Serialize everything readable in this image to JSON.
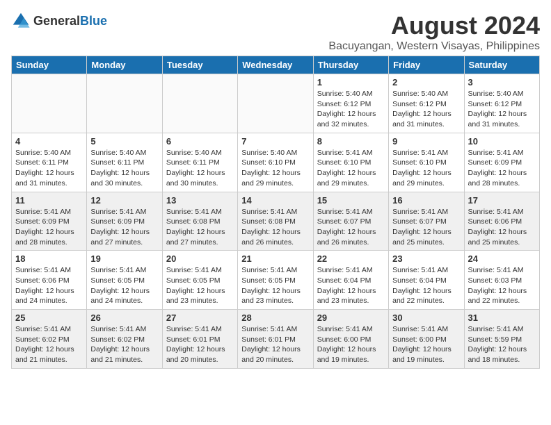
{
  "header": {
    "logo_general": "General",
    "logo_blue": "Blue",
    "month_year": "August 2024",
    "location": "Bacuyangan, Western Visayas, Philippines"
  },
  "days_of_week": [
    "Sunday",
    "Monday",
    "Tuesday",
    "Wednesday",
    "Thursday",
    "Friday",
    "Saturday"
  ],
  "weeks": [
    [
      {
        "day": "",
        "empty": true
      },
      {
        "day": "",
        "empty": true
      },
      {
        "day": "",
        "empty": true
      },
      {
        "day": "",
        "empty": true
      },
      {
        "day": "1",
        "sunrise": "Sunrise: 5:40 AM",
        "sunset": "Sunset: 6:12 PM",
        "daylight": "Daylight: 12 hours and 32 minutes."
      },
      {
        "day": "2",
        "sunrise": "Sunrise: 5:40 AM",
        "sunset": "Sunset: 6:12 PM",
        "daylight": "Daylight: 12 hours and 31 minutes."
      },
      {
        "day": "3",
        "sunrise": "Sunrise: 5:40 AM",
        "sunset": "Sunset: 6:12 PM",
        "daylight": "Daylight: 12 hours and 31 minutes."
      }
    ],
    [
      {
        "day": "4",
        "sunrise": "Sunrise: 5:40 AM",
        "sunset": "Sunset: 6:11 PM",
        "daylight": "Daylight: 12 hours and 31 minutes."
      },
      {
        "day": "5",
        "sunrise": "Sunrise: 5:40 AM",
        "sunset": "Sunset: 6:11 PM",
        "daylight": "Daylight: 12 hours and 30 minutes."
      },
      {
        "day": "6",
        "sunrise": "Sunrise: 5:40 AM",
        "sunset": "Sunset: 6:11 PM",
        "daylight": "Daylight: 12 hours and 30 minutes."
      },
      {
        "day": "7",
        "sunrise": "Sunrise: 5:40 AM",
        "sunset": "Sunset: 6:10 PM",
        "daylight": "Daylight: 12 hours and 29 minutes."
      },
      {
        "day": "8",
        "sunrise": "Sunrise: 5:41 AM",
        "sunset": "Sunset: 6:10 PM",
        "daylight": "Daylight: 12 hours and 29 minutes."
      },
      {
        "day": "9",
        "sunrise": "Sunrise: 5:41 AM",
        "sunset": "Sunset: 6:10 PM",
        "daylight": "Daylight: 12 hours and 29 minutes."
      },
      {
        "day": "10",
        "sunrise": "Sunrise: 5:41 AM",
        "sunset": "Sunset: 6:09 PM",
        "daylight": "Daylight: 12 hours and 28 minutes."
      }
    ],
    [
      {
        "day": "11",
        "sunrise": "Sunrise: 5:41 AM",
        "sunset": "Sunset: 6:09 PM",
        "daylight": "Daylight: 12 hours and 28 minutes."
      },
      {
        "day": "12",
        "sunrise": "Sunrise: 5:41 AM",
        "sunset": "Sunset: 6:09 PM",
        "daylight": "Daylight: 12 hours and 27 minutes."
      },
      {
        "day": "13",
        "sunrise": "Sunrise: 5:41 AM",
        "sunset": "Sunset: 6:08 PM",
        "daylight": "Daylight: 12 hours and 27 minutes."
      },
      {
        "day": "14",
        "sunrise": "Sunrise: 5:41 AM",
        "sunset": "Sunset: 6:08 PM",
        "daylight": "Daylight: 12 hours and 26 minutes."
      },
      {
        "day": "15",
        "sunrise": "Sunrise: 5:41 AM",
        "sunset": "Sunset: 6:07 PM",
        "daylight": "Daylight: 12 hours and 26 minutes."
      },
      {
        "day": "16",
        "sunrise": "Sunrise: 5:41 AM",
        "sunset": "Sunset: 6:07 PM",
        "daylight": "Daylight: 12 hours and 25 minutes."
      },
      {
        "day": "17",
        "sunrise": "Sunrise: 5:41 AM",
        "sunset": "Sunset: 6:06 PM",
        "daylight": "Daylight: 12 hours and 25 minutes."
      }
    ],
    [
      {
        "day": "18",
        "sunrise": "Sunrise: 5:41 AM",
        "sunset": "Sunset: 6:06 PM",
        "daylight": "Daylight: 12 hours and 24 minutes."
      },
      {
        "day": "19",
        "sunrise": "Sunrise: 5:41 AM",
        "sunset": "Sunset: 6:05 PM",
        "daylight": "Daylight: 12 hours and 24 minutes."
      },
      {
        "day": "20",
        "sunrise": "Sunrise: 5:41 AM",
        "sunset": "Sunset: 6:05 PM",
        "daylight": "Daylight: 12 hours and 23 minutes."
      },
      {
        "day": "21",
        "sunrise": "Sunrise: 5:41 AM",
        "sunset": "Sunset: 6:05 PM",
        "daylight": "Daylight: 12 hours and 23 minutes."
      },
      {
        "day": "22",
        "sunrise": "Sunrise: 5:41 AM",
        "sunset": "Sunset: 6:04 PM",
        "daylight": "Daylight: 12 hours and 23 minutes."
      },
      {
        "day": "23",
        "sunrise": "Sunrise: 5:41 AM",
        "sunset": "Sunset: 6:04 PM",
        "daylight": "Daylight: 12 hours and 22 minutes."
      },
      {
        "day": "24",
        "sunrise": "Sunrise: 5:41 AM",
        "sunset": "Sunset: 6:03 PM",
        "daylight": "Daylight: 12 hours and 22 minutes."
      }
    ],
    [
      {
        "day": "25",
        "sunrise": "Sunrise: 5:41 AM",
        "sunset": "Sunset: 6:02 PM",
        "daylight": "Daylight: 12 hours and 21 minutes."
      },
      {
        "day": "26",
        "sunrise": "Sunrise: 5:41 AM",
        "sunset": "Sunset: 6:02 PM",
        "daylight": "Daylight: 12 hours and 21 minutes."
      },
      {
        "day": "27",
        "sunrise": "Sunrise: 5:41 AM",
        "sunset": "Sunset: 6:01 PM",
        "daylight": "Daylight: 12 hours and 20 minutes."
      },
      {
        "day": "28",
        "sunrise": "Sunrise: 5:41 AM",
        "sunset": "Sunset: 6:01 PM",
        "daylight": "Daylight: 12 hours and 20 minutes."
      },
      {
        "day": "29",
        "sunrise": "Sunrise: 5:41 AM",
        "sunset": "Sunset: 6:00 PM",
        "daylight": "Daylight: 12 hours and 19 minutes."
      },
      {
        "day": "30",
        "sunrise": "Sunrise: 5:41 AM",
        "sunset": "Sunset: 6:00 PM",
        "daylight": "Daylight: 12 hours and 19 minutes."
      },
      {
        "day": "31",
        "sunrise": "Sunrise: 5:41 AM",
        "sunset": "Sunset: 5:59 PM",
        "daylight": "Daylight: 12 hours and 18 minutes."
      }
    ]
  ]
}
